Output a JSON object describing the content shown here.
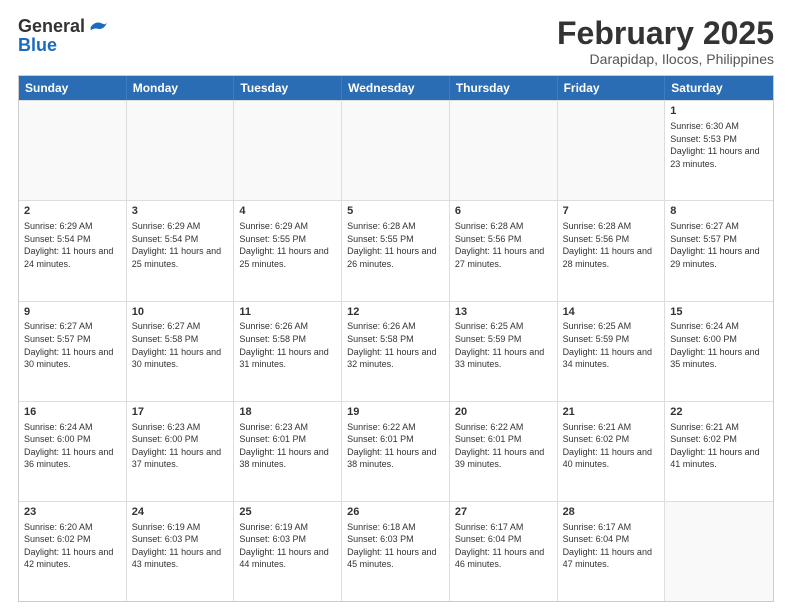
{
  "header": {
    "logo_general": "General",
    "logo_blue": "Blue",
    "month_title": "February 2025",
    "location": "Darapidap, Ilocos, Philippines"
  },
  "weekdays": [
    "Sunday",
    "Monday",
    "Tuesday",
    "Wednesday",
    "Thursday",
    "Friday",
    "Saturday"
  ],
  "rows": [
    [
      {
        "day": "",
        "info": ""
      },
      {
        "day": "",
        "info": ""
      },
      {
        "day": "",
        "info": ""
      },
      {
        "day": "",
        "info": ""
      },
      {
        "day": "",
        "info": ""
      },
      {
        "day": "",
        "info": ""
      },
      {
        "day": "1",
        "info": "Sunrise: 6:30 AM\nSunset: 5:53 PM\nDaylight: 11 hours and 23 minutes."
      }
    ],
    [
      {
        "day": "2",
        "info": "Sunrise: 6:29 AM\nSunset: 5:54 PM\nDaylight: 11 hours and 24 minutes."
      },
      {
        "day": "3",
        "info": "Sunrise: 6:29 AM\nSunset: 5:54 PM\nDaylight: 11 hours and 25 minutes."
      },
      {
        "day": "4",
        "info": "Sunrise: 6:29 AM\nSunset: 5:55 PM\nDaylight: 11 hours and 25 minutes."
      },
      {
        "day": "5",
        "info": "Sunrise: 6:28 AM\nSunset: 5:55 PM\nDaylight: 11 hours and 26 minutes."
      },
      {
        "day": "6",
        "info": "Sunrise: 6:28 AM\nSunset: 5:56 PM\nDaylight: 11 hours and 27 minutes."
      },
      {
        "day": "7",
        "info": "Sunrise: 6:28 AM\nSunset: 5:56 PM\nDaylight: 11 hours and 28 minutes."
      },
      {
        "day": "8",
        "info": "Sunrise: 6:27 AM\nSunset: 5:57 PM\nDaylight: 11 hours and 29 minutes."
      }
    ],
    [
      {
        "day": "9",
        "info": "Sunrise: 6:27 AM\nSunset: 5:57 PM\nDaylight: 11 hours and 30 minutes."
      },
      {
        "day": "10",
        "info": "Sunrise: 6:27 AM\nSunset: 5:58 PM\nDaylight: 11 hours and 30 minutes."
      },
      {
        "day": "11",
        "info": "Sunrise: 6:26 AM\nSunset: 5:58 PM\nDaylight: 11 hours and 31 minutes."
      },
      {
        "day": "12",
        "info": "Sunrise: 6:26 AM\nSunset: 5:58 PM\nDaylight: 11 hours and 32 minutes."
      },
      {
        "day": "13",
        "info": "Sunrise: 6:25 AM\nSunset: 5:59 PM\nDaylight: 11 hours and 33 minutes."
      },
      {
        "day": "14",
        "info": "Sunrise: 6:25 AM\nSunset: 5:59 PM\nDaylight: 11 hours and 34 minutes."
      },
      {
        "day": "15",
        "info": "Sunrise: 6:24 AM\nSunset: 6:00 PM\nDaylight: 11 hours and 35 minutes."
      }
    ],
    [
      {
        "day": "16",
        "info": "Sunrise: 6:24 AM\nSunset: 6:00 PM\nDaylight: 11 hours and 36 minutes."
      },
      {
        "day": "17",
        "info": "Sunrise: 6:23 AM\nSunset: 6:00 PM\nDaylight: 11 hours and 37 minutes."
      },
      {
        "day": "18",
        "info": "Sunrise: 6:23 AM\nSunset: 6:01 PM\nDaylight: 11 hours and 38 minutes."
      },
      {
        "day": "19",
        "info": "Sunrise: 6:22 AM\nSunset: 6:01 PM\nDaylight: 11 hours and 38 minutes."
      },
      {
        "day": "20",
        "info": "Sunrise: 6:22 AM\nSunset: 6:01 PM\nDaylight: 11 hours and 39 minutes."
      },
      {
        "day": "21",
        "info": "Sunrise: 6:21 AM\nSunset: 6:02 PM\nDaylight: 11 hours and 40 minutes."
      },
      {
        "day": "22",
        "info": "Sunrise: 6:21 AM\nSunset: 6:02 PM\nDaylight: 11 hours and 41 minutes."
      }
    ],
    [
      {
        "day": "23",
        "info": "Sunrise: 6:20 AM\nSunset: 6:02 PM\nDaylight: 11 hours and 42 minutes."
      },
      {
        "day": "24",
        "info": "Sunrise: 6:19 AM\nSunset: 6:03 PM\nDaylight: 11 hours and 43 minutes."
      },
      {
        "day": "25",
        "info": "Sunrise: 6:19 AM\nSunset: 6:03 PM\nDaylight: 11 hours and 44 minutes."
      },
      {
        "day": "26",
        "info": "Sunrise: 6:18 AM\nSunset: 6:03 PM\nDaylight: 11 hours and 45 minutes."
      },
      {
        "day": "27",
        "info": "Sunrise: 6:17 AM\nSunset: 6:04 PM\nDaylight: 11 hours and 46 minutes."
      },
      {
        "day": "28",
        "info": "Sunrise: 6:17 AM\nSunset: 6:04 PM\nDaylight: 11 hours and 47 minutes."
      },
      {
        "day": "",
        "info": ""
      }
    ]
  ]
}
